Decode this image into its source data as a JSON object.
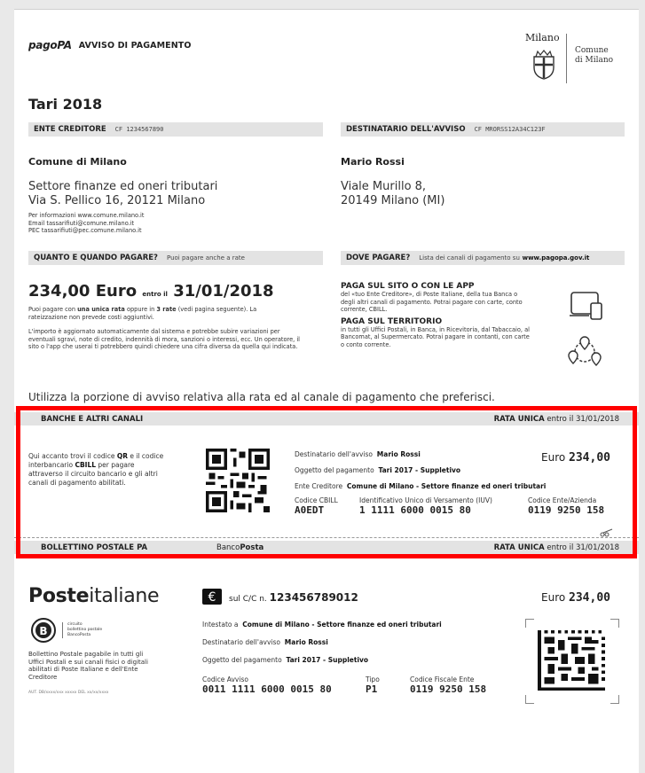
{
  "header": {
    "logo": "pagoPA",
    "title": "AVVISO DI PAGAMENTO",
    "milano_name": "Milano",
    "comune_line1": "Comune",
    "comune_line2": "di Milano"
  },
  "doc_title": "Tari 2018",
  "ente": {
    "bar_label": "ENTE CREDITORE",
    "bar_cf": "CF 1234567890",
    "name": "Comune di Milano",
    "line1": "Settore finanze ed oneri tributari",
    "line2": "Via S. Pellico 16, 20121 Milano",
    "info1": "Per informazioni www.comune.milano.it",
    "info2": "Email tassarifiuti@comune.milano.it",
    "info3": "PEC tassarifiuti@pec.comune.milano.it"
  },
  "destinatario": {
    "bar_label": "DESTINATARIO DELL'AVVISO",
    "bar_cf": "CF MRORSS12A34C123F",
    "name": "Mario Rossi",
    "line1": "Viale Murillo 8,",
    "line2": "20149 Milano (MI)"
  },
  "quanto": {
    "bar_label": "QUANTO E QUANDO PAGARE?",
    "bar_sub": "Puoi pagare anche a rate",
    "amount": "234,00 Euro",
    "entro": "entro il",
    "date": "31/01/2018",
    "p1a": "Puoi pagare con ",
    "p1b": "una unica rata",
    "p1c": " oppure in ",
    "p1d": "3 rate",
    "p1e": " (vedi pagina seguente). La rateizzazione non prevede costi aggiuntivi.",
    "p2": "L'importo è aggiornato automaticamente dal sistema e potrebbe subire variazioni per eventuali sgravi, note di credito, indennità di mora, sanzioni o interessi, ecc. Un operatore, il sito o l'app che userai ti potrebbero quindi chiedere una cifra diversa da quella qui indicata."
  },
  "dove": {
    "bar_label": "DOVE PAGARE?",
    "bar_sub": "Lista dei canali di pagamento su",
    "bar_link": "www.pagopa.gov.it",
    "h1": "PAGA SUL SITO O CON LE APP",
    "t1": "del «tuo Ente Creditore», di Poste Italiane, della tua Banca o degli altri canali di pagamento. Potrai pagare con carte, conto corrente, CBILL.",
    "h2": "PAGA SUL TERRITORIO",
    "t2": "in tutti gli Uffici Postali, in Banca, in Ricevitoria, dal Tabaccaio, al Bancomat, al Supermercato. Potrai pagare in contanti, con carte o conto corrente."
  },
  "utilizza": "Utilizza la porzione di avviso relativa alla rata ed al canale di pagamento che preferisci.",
  "banche": {
    "head_label": "BANCHE E ALTRI CANALI",
    "head_rata": "RATA UNICA",
    "head_entro": "entro il 31/01/2018",
    "desc_a": "Qui accanto trovi il codice ",
    "desc_qr": "QR",
    "desc_b": " e il codice interbancario ",
    "desc_cbill": "CBILL",
    "desc_c": " per pagare attraverso il circuito bancario e gli altri canali di pagamento abilitati.",
    "dest_label": "Destinatario dell'avviso",
    "dest_value": "Mario Rossi",
    "ogg_label": "Oggetto del pagamento",
    "ogg_value": "Tari 2017 - Suppletivo",
    "ente_label": "Ente Creditore",
    "ente_value": "Comune di Milano - Settore finanze ed oneri tributari",
    "euro_label": "Euro",
    "euro_value": "234,00",
    "cbill_label": "Codice CBILL",
    "cbill_value": "A0EDT",
    "iuv_label": "Identificativo Unico di Versamento (IUV)",
    "iuv_value": "1 1111 6000 0015 80",
    "cea_label": "Codice Ente/Azienda",
    "cea_value": "0119 9250 158"
  },
  "postale": {
    "head_label": "BOLLETTINO POSTALE PA",
    "head_banco": "Banco",
    "head_posta": "Posta",
    "head_rata": "RATA UNICA",
    "head_entro": "entro il 31/01/2018",
    "poste_a": "Poste",
    "poste_b": "italiane",
    "badge_t1": "circuito",
    "badge_t2": "bollettino postale",
    "badge_t3": "BancoPosta",
    "desc": "Bollettino Postale pagabile in tutti gli Uffici Postali e sui canali fisici o digitali abilitati di Poste Italiane e dell'Ente Creditore",
    "aut": "AUT. DB/xxxx/xxx xxxxx DEL xx/xx/xxxx",
    "cc_label": "sul C/C n.",
    "cc_value": "123456789012",
    "euro_label": "Euro",
    "euro_value": "234,00",
    "int_label": "Intestato a",
    "int_value": "Comune di Milano - Settore finanze ed oneri tributari",
    "dest_label": "Destinatario dell'avviso",
    "dest_value": "Mario Rossi",
    "ogg_label": "Oggetto del pagamento",
    "ogg_value": "Tari 2017 - Suppletivo",
    "avviso_label": "Codice Avviso",
    "avviso_value": "0011 1111 6000 0015 80",
    "tipo_label": "Tipo",
    "tipo_value": "P1",
    "cf_label": "Codice Fiscale Ente",
    "cf_value": "0119 9250 158"
  },
  "colors": {
    "highlight": "#ff0000",
    "bar": "#e3e3e3"
  }
}
